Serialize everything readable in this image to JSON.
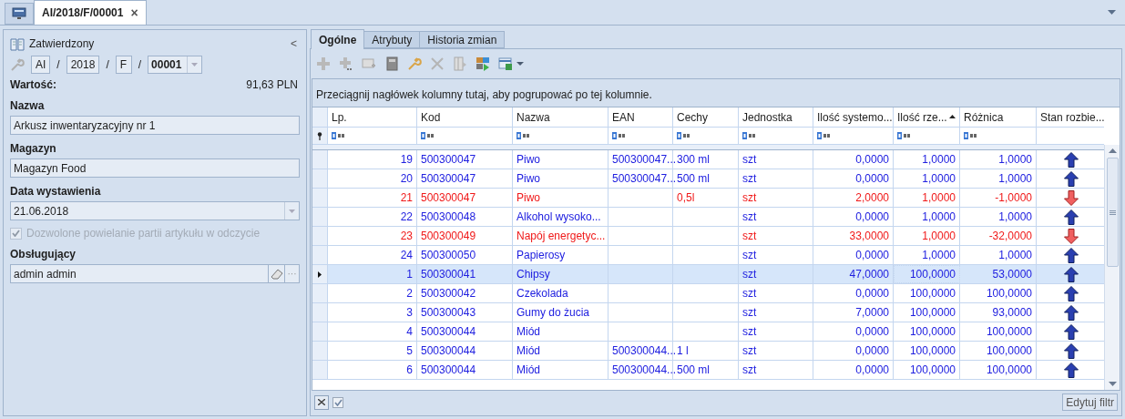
{
  "document_tab": {
    "title": "AI/2018/F/00001",
    "close": "×"
  },
  "header": {
    "status": "Zatwierdzony",
    "collapse": "<",
    "number_parts": [
      "AI",
      "2018",
      "F",
      "00001"
    ],
    "separator": "/",
    "value_label": "Wartość:",
    "value": "91,63 PLN"
  },
  "fields": [
    {
      "label": "Nazwa",
      "value": "Arkusz inwentaryzacyjny nr 1",
      "kind": "text"
    },
    {
      "label": "Magazyn",
      "value": "Magazyn Food",
      "kind": "text"
    },
    {
      "label": "Data wystawienia",
      "value": "21.06.2018",
      "kind": "dropdown"
    }
  ],
  "duplicate_option": {
    "label": "Dozwolone powielanie partii artykułu w odczycie",
    "checked": true,
    "disabled": true
  },
  "operator": {
    "label": "Obsługujący",
    "value": "admin admin",
    "more": "···"
  },
  "tabs": [
    {
      "label": "Ogólne",
      "selected": true
    },
    {
      "label": "Atrybuty",
      "selected": false
    },
    {
      "label": "Historia zmian",
      "selected": false
    }
  ],
  "group_hint": "Przeciągnij nagłówek kolumny tutaj, aby pogrupować po tej kolumnie.",
  "table": {
    "columns": [
      {
        "label": "Lp.",
        "sorted": false
      },
      {
        "label": "Kod",
        "sorted": false
      },
      {
        "label": "Nazwa",
        "sorted": false
      },
      {
        "label": "EAN",
        "sorted": false
      },
      {
        "label": "Cechy",
        "sorted": false
      },
      {
        "label": "Jednostka",
        "sorted": false
      },
      {
        "label": "Ilość systemo...",
        "sorted": false
      },
      {
        "label": "Ilość rze...",
        "sorted": true
      },
      {
        "label": "Różnica",
        "sorted": false
      },
      {
        "label": "Stan rozbie...",
        "sorted": false
      }
    ],
    "rows": [
      {
        "cells": [
          "19",
          "500300047",
          "Piwo",
          "500300047...",
          "300 ml",
          "szt",
          "0,0000",
          "1,0000",
          "1,0000"
        ],
        "kind": "surplus",
        "selected": false
      },
      {
        "cells": [
          "20",
          "500300047",
          "Piwo",
          "500300047...",
          "500 ml",
          "szt",
          "0,0000",
          "1,0000",
          "1,0000"
        ],
        "kind": "surplus",
        "selected": false
      },
      {
        "cells": [
          "21",
          "500300047",
          "Piwo",
          "",
          "0,5l",
          "szt",
          "2,0000",
          "1,0000",
          "-1,0000"
        ],
        "kind": "shortage",
        "selected": false
      },
      {
        "cells": [
          "22",
          "500300048",
          "Alkohol wysoko...",
          "",
          "",
          "szt",
          "0,0000",
          "1,0000",
          "1,0000"
        ],
        "kind": "surplus",
        "selected": false
      },
      {
        "cells": [
          "23",
          "500300049",
          "Napój energetyc...",
          "",
          "",
          "szt",
          "33,0000",
          "1,0000",
          "-32,0000"
        ],
        "kind": "shortage",
        "selected": false
      },
      {
        "cells": [
          "24",
          "500300050",
          "Papierosy",
          "",
          "",
          "szt",
          "0,0000",
          "1,0000",
          "1,0000"
        ],
        "kind": "surplus",
        "selected": false
      },
      {
        "cells": [
          "1",
          "500300041",
          "Chipsy",
          "",
          "",
          "szt",
          "47,0000",
          "100,0000",
          "53,0000"
        ],
        "kind": "surplus",
        "selected": true
      },
      {
        "cells": [
          "2",
          "500300042",
          "Czekolada",
          "",
          "",
          "szt",
          "0,0000",
          "100,0000",
          "100,0000"
        ],
        "kind": "surplus",
        "selected": false
      },
      {
        "cells": [
          "3",
          "500300043",
          "Gumy do żucia",
          "",
          "",
          "szt",
          "7,0000",
          "100,0000",
          "93,0000"
        ],
        "kind": "surplus",
        "selected": false
      },
      {
        "cells": [
          "4",
          "500300044",
          "Miód",
          "",
          "",
          "szt",
          "0,0000",
          "100,0000",
          "100,0000"
        ],
        "kind": "surplus",
        "selected": false
      },
      {
        "cells": [
          "5",
          "500300044",
          "Miód",
          "500300044...",
          "1 l",
          "szt",
          "0,0000",
          "100,0000",
          "100,0000"
        ],
        "kind": "surplus",
        "selected": false
      },
      {
        "cells": [
          "6",
          "500300044",
          "Miód",
          "500300044...",
          "500 ml",
          "szt",
          "0,0000",
          "100,0000",
          "100,0000"
        ],
        "kind": "surplus",
        "selected": false
      }
    ]
  },
  "filter_bar": {
    "enabled": true,
    "edit_button": "Edytuj filtr"
  }
}
